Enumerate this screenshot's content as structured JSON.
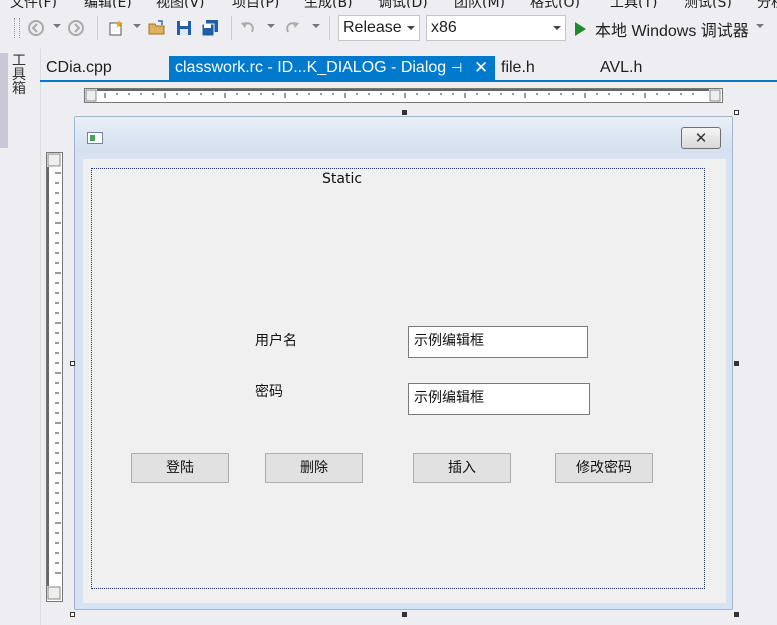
{
  "menu": {
    "items": [
      "文件(F)",
      "编辑(E)",
      "视图(V)",
      "项目(P)",
      "生成(B)",
      "调试(D)",
      "团队(M)",
      "格式(O)",
      "工具(T)",
      "测试(S)",
      "分析"
    ]
  },
  "toolbar": {
    "configuration": "Release",
    "platform": "x86",
    "run_label": "本地 Windows 调试器"
  },
  "toolbox": {
    "label": "工具箱"
  },
  "tabs": [
    {
      "label": "CDia.cpp",
      "active": false
    },
    {
      "label": "classwork.rc - ID...K_DIALOG - Dialog",
      "active": true,
      "pin": "⊣",
      "close": "✕"
    },
    {
      "label": "file.h",
      "active": false
    },
    {
      "label": "AVL.h",
      "active": false
    }
  ],
  "dialog": {
    "close_glyph": "✕",
    "static_label": "Static",
    "username_label": "用户名",
    "password_label": "密码",
    "username_edit_value": "示例编辑框",
    "password_edit_value": "示例编辑框",
    "buttons": {
      "login": "登陆",
      "delete": "删除",
      "insert": "插入",
      "change_password": "修改密码"
    }
  },
  "colors": {
    "accent": "#007acc",
    "run_green": "#1e8a2c",
    "guide": "#1a2f6e"
  }
}
